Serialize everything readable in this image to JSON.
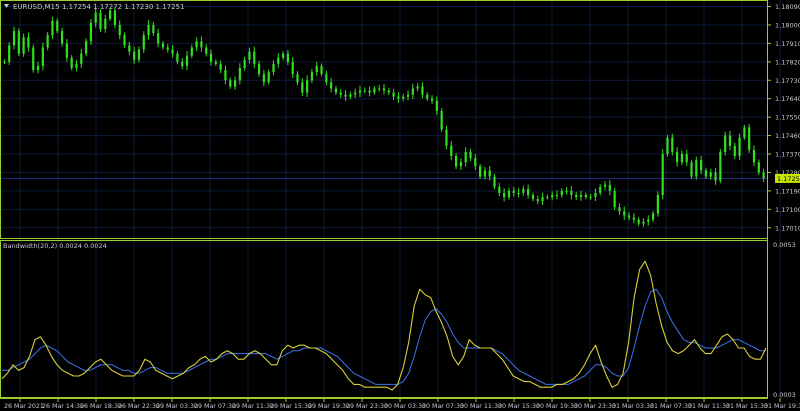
{
  "colors": {
    "background": "#000000",
    "frame": "#9acd32",
    "grid": "#0d1b3a",
    "text": "#c8c8c8",
    "candle": "#32e01e",
    "indicator_main": "#d8cf3a",
    "indicator_signal": "#3b73e6",
    "price_line": "#1f2d8a",
    "price_tag_bg": "#c8e600",
    "price_tag_text": "#000000"
  },
  "header": {
    "arrow_icon": "triangle-down-icon",
    "symbol": "EURUSD,M15",
    "ohlc": "1.17254 1.17272 1.17230 1.17251"
  },
  "price_axis": {
    "labels": [
      "1.18090",
      "1.18000",
      "1.17910",
      "1.17820",
      "1.17730",
      "1.17640",
      "1.17550",
      "1.17460",
      "1.17370",
      "1.17280",
      "1.17190",
      "1.17100",
      "1.17010"
    ],
    "current_price": "1.17251"
  },
  "indicator": {
    "title": "Bandwidth(20,2) 0.0024 0.0024",
    "axis_top": "0.0053",
    "axis_bottom": "0.0003"
  },
  "time_axis": {
    "labels": [
      "26 Mar 2021",
      "26 Mar 14:30",
      "26 Mar 18:30",
      "26 Mar 22:30",
      "29 Mar 03:30",
      "29 Mar 07:30",
      "29 Mar 11:30",
      "29 Mar 15:30",
      "29 Mar 19:30",
      "29 Mar 23:30",
      "30 Mar 03:30",
      "30 Mar 07:30",
      "30 Mar 11:30",
      "30 Mar 15:30",
      "30 Mar 19:30",
      "30 Mar 23:30",
      "31 Mar 03:30",
      "31 Mar 07:30",
      "31 Mar 11:30",
      "31 Mar 15:30",
      "31 Mar 19:30"
    ]
  },
  "chart_data": {
    "type": "line",
    "symbol": "EURUSD",
    "timeframe": "M15",
    "price_ylim": [
      1.16965,
      1.18112
    ],
    "indicator_ylim": [
      0.0003,
      0.0053
    ],
    "close": [
      1.1782,
      1.179,
      1.1797,
      1.1786,
      1.1794,
      1.1789,
      1.1778,
      1.178,
      1.1789,
      1.1795,
      1.1802,
      1.1797,
      1.1791,
      1.1784,
      1.1779,
      1.1781,
      1.1786,
      1.1792,
      1.1801,
      1.1806,
      1.1798,
      1.1803,
      1.1807,
      1.18,
      1.1795,
      1.179,
      1.1787,
      1.1783,
      1.1788,
      1.1795,
      1.18,
      1.1796,
      1.1791,
      1.1789,
      1.1788,
      1.1786,
      1.1782,
      1.178,
      1.1785,
      1.1789,
      1.1792,
      1.1789,
      1.1786,
      1.1782,
      1.1781,
      1.1778,
      1.1773,
      1.177,
      1.1773,
      1.1779,
      1.1783,
      1.1787,
      1.1781,
      1.1776,
      1.1772,
      1.1777,
      1.1781,
      1.1784,
      1.1786,
      1.1782,
      1.1776,
      1.1772,
      1.1767,
      1.1773,
      1.1777,
      1.178,
      1.1776,
      1.1772,
      1.1769,
      1.1767,
      1.1766,
      1.1765,
      1.1766,
      1.1767,
      1.1768,
      1.1768,
      1.1767,
      1.1769,
      1.1769,
      1.1768,
      1.1767,
      1.1765,
      1.1764,
      1.1765,
      1.1766,
      1.1769,
      1.177,
      1.1766,
      1.1764,
      1.1763,
      1.1758,
      1.1749,
      1.1741,
      1.1736,
      1.1731,
      1.1733,
      1.1738,
      1.1735,
      1.1731,
      1.1726,
      1.1729,
      1.1726,
      1.1721,
      1.1718,
      1.1716,
      1.1719,
      1.1718,
      1.1718,
      1.172,
      1.1717,
      1.1715,
      1.1714,
      1.1716,
      1.1716,
      1.1717,
      1.1717,
      1.1719,
      1.1719,
      1.1717,
      1.1716,
      1.1717,
      1.1716,
      1.1716,
      1.1718,
      1.1721,
      1.1722,
      1.1719,
      1.1711,
      1.1709,
      1.1707,
      1.1706,
      1.1705,
      1.1703,
      1.1704,
      1.1705,
      1.1708,
      1.1717,
      1.1737,
      1.1745,
      1.1738,
      1.1733,
      1.1737,
      1.1733,
      1.1726,
      1.1734,
      1.1729,
      1.1726,
      1.1728,
      1.1724,
      1.1738,
      1.1746,
      1.1741,
      1.1736,
      1.1745,
      1.175,
      1.1739,
      1.1733,
      1.1728,
      1.1725
    ],
    "bandwidth": [
      0.0007,
      0.0009,
      0.0012,
      0.001,
      0.0011,
      0.0015,
      0.0021,
      0.0022,
      0.0019,
      0.0015,
      0.0012,
      0.001,
      0.0009,
      0.0008,
      0.0008,
      0.0009,
      0.0011,
      0.0013,
      0.0014,
      0.0012,
      0.001,
      0.0009,
      0.0008,
      0.0008,
      0.0008,
      0.001,
      0.0014,
      0.0013,
      0.001,
      0.0009,
      0.0008,
      0.0007,
      0.0008,
      0.0009,
      0.0011,
      0.0012,
      0.0014,
      0.0015,
      0.0013,
      0.0014,
      0.0016,
      0.0017,
      0.0016,
      0.0014,
      0.0014,
      0.0016,
      0.0017,
      0.0016,
      0.0014,
      0.0012,
      0.0012,
      0.0017,
      0.0019,
      0.0018,
      0.0019,
      0.0019,
      0.0018,
      0.0018,
      0.0017,
      0.0016,
      0.0014,
      0.0012,
      0.001,
      0.0007,
      0.0005,
      0.0005,
      0.0004,
      0.0004,
      0.0004,
      0.0004,
      0.0004,
      0.0003,
      0.0005,
      0.0011,
      0.002,
      0.0033,
      0.0039,
      0.0037,
      0.0036,
      0.0031,
      0.0027,
      0.0022,
      0.0015,
      0.0012,
      0.0015,
      0.0021,
      0.0019,
      0.0018,
      0.0018,
      0.0018,
      0.0016,
      0.0014,
      0.0011,
      0.0008,
      0.0007,
      0.0006,
      0.0006,
      0.0005,
      0.0004,
      0.0004,
      0.0004,
      0.0005,
      0.0005,
      0.0006,
      0.0007,
      0.0009,
      0.0012,
      0.0016,
      0.0019,
      0.0013,
      0.0008,
      0.0004,
      0.0005,
      0.0009,
      0.002,
      0.0036,
      0.0046,
      0.0049,
      0.0044,
      0.0034,
      0.0026,
      0.002,
      0.0017,
      0.0016,
      0.0017,
      0.0019,
      0.0021,
      0.0018,
      0.0016,
      0.0016,
      0.0019,
      0.0022,
      0.0023,
      0.0021,
      0.0018,
      0.0018,
      0.0015,
      0.0014,
      0.0014,
      0.0018
    ],
    "bandwidth_signal": [
      0.001,
      0.001,
      0.0011,
      0.0012,
      0.0013,
      0.0014,
      0.0016,
      0.0018,
      0.0019,
      0.0018,
      0.0017,
      0.0015,
      0.0013,
      0.0012,
      0.0011,
      0.001,
      0.001,
      0.0011,
      0.0012,
      0.0012,
      0.0012,
      0.0011,
      0.001,
      0.001,
      0.0009,
      0.0009,
      0.001,
      0.0011,
      0.0011,
      0.001,
      0.0009,
      0.0009,
      0.0009,
      0.0009,
      0.001,
      0.0011,
      0.0012,
      0.0013,
      0.0014,
      0.0014,
      0.0015,
      0.0016,
      0.0016,
      0.0016,
      0.0016,
      0.0016,
      0.0016,
      0.0016,
      0.0016,
      0.0015,
      0.0014,
      0.0015,
      0.0016,
      0.0017,
      0.0017,
      0.0018,
      0.0018,
      0.0018,
      0.0018,
      0.0017,
      0.0016,
      0.0015,
      0.0013,
      0.0011,
      0.0009,
      0.0008,
      0.0007,
      0.0006,
      0.0005,
      0.0005,
      0.0005,
      0.0005,
      0.0005,
      0.0006,
      0.0009,
      0.0015,
      0.0022,
      0.0028,
      0.0031,
      0.0032,
      0.003,
      0.0027,
      0.0023,
      0.002,
      0.0018,
      0.0018,
      0.0018,
      0.0018,
      0.0018,
      0.0018,
      0.0017,
      0.0016,
      0.0014,
      0.0012,
      0.001,
      0.0009,
      0.0008,
      0.0007,
      0.0006,
      0.0005,
      0.0005,
      0.0005,
      0.0005,
      0.0005,
      0.0006,
      0.0007,
      0.0008,
      0.001,
      0.0012,
      0.0012,
      0.0011,
      0.0009,
      0.0008,
      0.0008,
      0.0011,
      0.0018,
      0.0026,
      0.0033,
      0.0038,
      0.0039,
      0.0036,
      0.0031,
      0.0027,
      0.0024,
      0.0021,
      0.002,
      0.002,
      0.0019,
      0.0018,
      0.0018,
      0.0018,
      0.0019,
      0.002,
      0.0021,
      0.0021,
      0.002,
      0.0019,
      0.0018,
      0.0017,
      0.0017
    ]
  }
}
